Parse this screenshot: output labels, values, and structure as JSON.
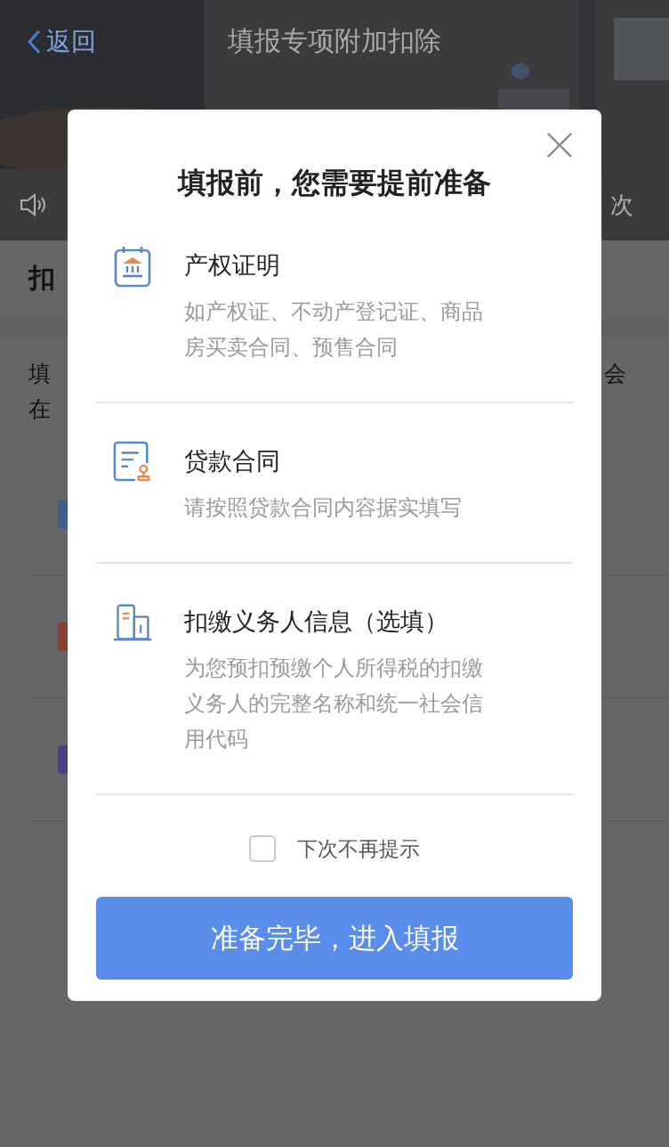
{
  "backdrop": {
    "nav": {
      "back_label": "返回",
      "title": "填报专项附加扣除"
    },
    "audio_bar": {
      "text": "次"
    },
    "section_title": "扣",
    "intro_lines": [
      {
        "start": "填",
        "end": "会"
      },
      {
        "start": "在"
      }
    ],
    "rows": [
      {
        "color": "#3d5f8f"
      },
      {
        "color": "#8c3f2c"
      },
      {
        "color": "#4a4088"
      }
    ]
  },
  "dialog": {
    "title": "填报前，您需要提前准备",
    "items": [
      {
        "kind": "property",
        "title": "产权证明",
        "description": "如产权证、不动产登记证、商品房买卖合同、预售合同"
      },
      {
        "kind": "contract",
        "title": "贷款合同",
        "description": "请按照贷款合同内容据实填写"
      },
      {
        "kind": "employer",
        "title": "扣缴义务人信息（选填）",
        "description": "为您预扣预缴个人所得税的扣缴义务人的完整名称和统一社会信用代码"
      }
    ],
    "checkbox": {
      "label": "下次不再提示",
      "checked": false
    },
    "button": "准备完毕，进入填报"
  }
}
